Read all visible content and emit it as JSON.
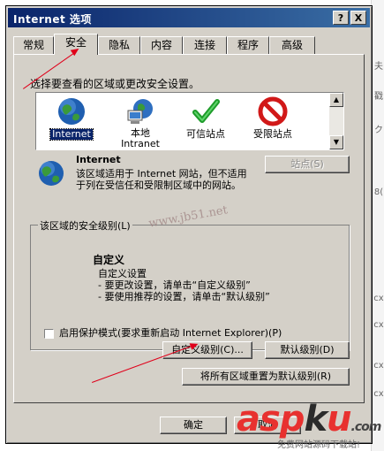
{
  "window": {
    "title": "Internet 选项",
    "help_label": "?",
    "close_label": "X"
  },
  "tabs": [
    {
      "label": "常规"
    },
    {
      "label": "安全",
      "active": true
    },
    {
      "label": "隐私"
    },
    {
      "label": "内容"
    },
    {
      "label": "连接"
    },
    {
      "label": "程序"
    },
    {
      "label": "高级"
    }
  ],
  "security": {
    "prompt": "选择要查看的区域或更改安全设置。",
    "zones": [
      {
        "label": "Internet",
        "icon": "globe-icon",
        "selected": true
      },
      {
        "label": "本地\nIntranet",
        "icon": "intranet-icon"
      },
      {
        "label": "可信站点",
        "icon": "check-icon"
      },
      {
        "label": "受限站点",
        "icon": "prohibited-icon"
      }
    ],
    "info": {
      "title": "Internet",
      "description": "该区域适用于 Internet 网站，但不适用于列在受信任和受限制区域中的网站。"
    },
    "sites_button": "站点(S)",
    "level_group": {
      "title": "该区域的安全级别(L)",
      "level_name": "自定义",
      "desc_line1": "自定义设置",
      "desc_line2": "- 要更改设置，请单击“自定义级别”",
      "desc_line3": "- 要使用推荐的设置，请单击“默认级别”"
    },
    "protected_mode": {
      "label": "启用保护模式(要求重新启动 Internet Explorer)(P)",
      "checked": false
    },
    "custom_level_button": "自定义级别(C)...",
    "default_level_button": "默认级别(D)",
    "reset_all_button": "将所有区域重置为默认级别(R)"
  },
  "footer": {
    "ok_label": "确定",
    "cancel_label": "取消"
  },
  "background_glyphs": [
    "夫",
    "戳",
    "ク",
    "8(",
    "cx",
    "cx",
    "cx",
    "cx"
  ],
  "overlay": {
    "watermark": "www.jb51.net",
    "logo_red1": "asp",
    "logo_dark": "k",
    "logo_red2": "u",
    "logo_suffix": ".com",
    "logo_tagline": "免费网站源码下载站!"
  },
  "colors": {
    "title_bar": "#0a246a",
    "face": "#d4d0c8",
    "selection": "#0a246a",
    "annotation_arrow": "#e0001a",
    "logo_red": "#e8312f"
  }
}
